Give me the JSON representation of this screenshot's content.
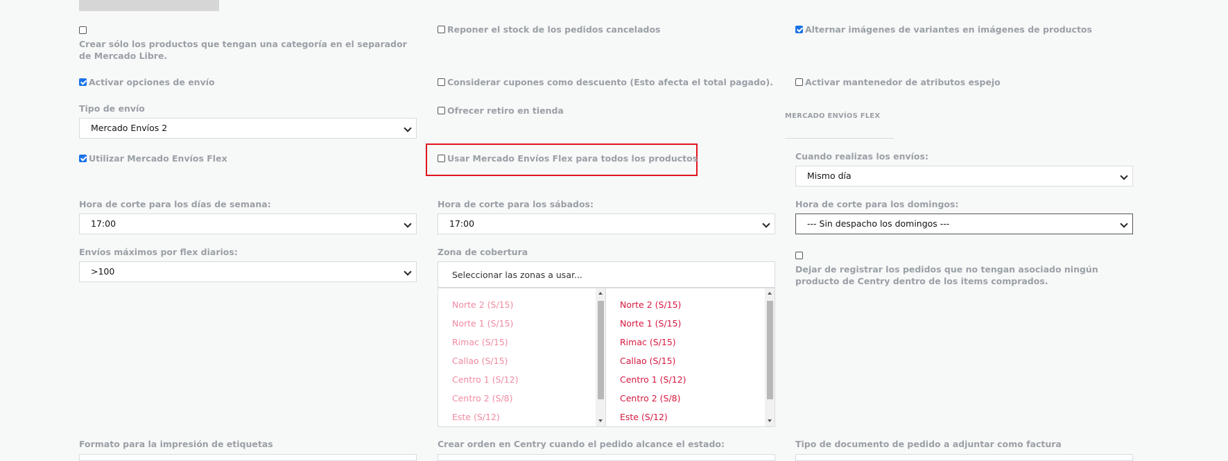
{
  "top": {
    "create_only_label": "Crear sólo los productos que tengan una categoría en el separador de Mercado Libre.",
    "restock_label": "Reponer el stock de los pedidos cancelados",
    "alternate_images_label": "Alternar imágenes de variantes en imágenes de productos"
  },
  "row2": {
    "shipping_options_label": "Activar opciones de envío",
    "coupons_label": "Considerar cupones como descuento (Esto afecta el total pagado).",
    "mirror_attrs_label": "Activar mantenedor de atributos espejo"
  },
  "shipping": {
    "type_label": "Tipo de envío",
    "type_value": "Mercado Envíos 2",
    "store_pickup_label": "Ofrecer retiro en tienda",
    "flex_section_title": "MERCADO ENVÍOS FLEX"
  },
  "flex": {
    "use_flex_label": "Utilizar Mercado Envíos Flex",
    "use_flex_all_label": "Usar Mercado Envíos Flex para todos los productos",
    "when_label": "Cuando realizas los envíos:",
    "when_value": "Mismo día"
  },
  "cutoff": {
    "weekday_label": "Hora de corte para los días de semana:",
    "weekday_value": "17:00",
    "saturday_label": "Hora de corte para los sábados:",
    "saturday_value": "17:00",
    "sunday_label": "Hora de corte para los domingos:",
    "sunday_value": "--- Sin despacho los domingos ---"
  },
  "max_flex": {
    "label": "Envíos máximos por flex diarios:",
    "value": ">100"
  },
  "coverage": {
    "label": "Zona de cobertura",
    "placeholder": "Seleccionar las zonas a usar...",
    "available": [
      "Norte 2 (S/15)",
      "Norte 1 (S/15)",
      "Rimac (S/15)",
      "Callao (S/15)",
      "Centro 1 (S/12)",
      "Centro 2 (S/8)",
      "Este (S/12)"
    ],
    "selected": [
      "Norte 2 (S/15)",
      "Norte 1 (S/15)",
      "Rimac (S/15)",
      "Callao (S/15)",
      "Centro 1 (S/12)",
      "Centro 2 (S/8)",
      "Este (S/12)"
    ]
  },
  "stop_register_label": "Dejar de registrar los pedidos que no tengan asociado ningún producto de Centry dentro de los items comprados.",
  "bottom": {
    "label_format": "Formato para la impresión de etiquetas",
    "create_order_state": "Crear orden en Centry cuando el pedido alcance el estado:",
    "doc_type": "Tipo de documento de pedido a adjuntar como factura"
  },
  "colors": {
    "accent": "#1a73e8",
    "highlight": "#e0141e",
    "zone_selected": "#d6173f",
    "zone_available": "#f08aa0"
  }
}
